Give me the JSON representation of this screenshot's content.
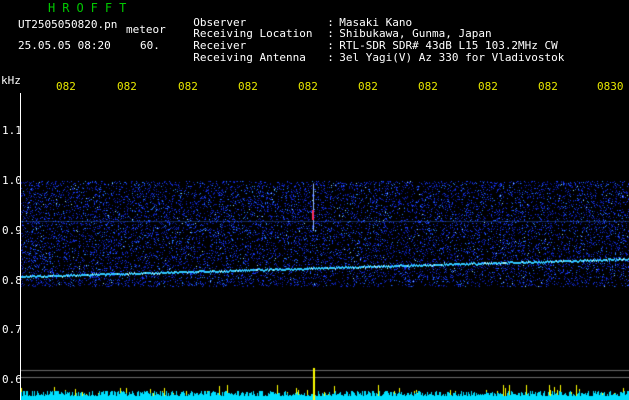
{
  "header": {
    "app_title": "HROFFT",
    "file_name": "UT2505050820.pn",
    "mode_label": "meteor",
    "datetime": "25.05.05 08:20",
    "interval": "60."
  },
  "station_info": [
    {
      "label": "Observer",
      "value": "Masaki Kano"
    },
    {
      "label": "Receiving Location",
      "value": "Shibukawa, Gunma, Japan"
    },
    {
      "label": "Receiver",
      "value": "RTL-SDR SDR# 43dB L15 103.2MHz CW"
    },
    {
      "label": "Receiving Antenna",
      "value": "3el Yagi(V) Az 330 for Vladivostok"
    }
  ],
  "axes": {
    "unit_label": "kHz",
    "time_ticks": [
      "082",
      "082",
      "082",
      "082",
      "082",
      "082",
      "082",
      "082",
      "082",
      "0830"
    ],
    "freq_ticks": [
      "1.1",
      "1.0",
      "0.9",
      "0.8",
      "0.7",
      "0.6"
    ]
  },
  "colors": {
    "background": "#000000",
    "time_tick": "#e6e600",
    "title": "#00c800",
    "noise": "#1a3cff",
    "trail": "#30c8ff",
    "meteor": "#ff3060",
    "level_bar": "#00e0ff",
    "level_peak": "#ffff00"
  },
  "chart_data": {
    "type": "heatmap",
    "x_ticks": [
      "082",
      "082",
      "082",
      "082",
      "082",
      "082",
      "082",
      "082",
      "082",
      "0830"
    ],
    "y_ticks": [
      1.1,
      1.0,
      0.9,
      0.8,
      0.7,
      0.6
    ],
    "y_unit": "kHz",
    "ylim": [
      0.6,
      1.1
    ],
    "noise_band_khz": [
      0.8,
      1.0
    ],
    "carrier_khz_start": 0.81,
    "carrier_khz_end": 0.845,
    "meteor_event": {
      "time_fraction": 0.48,
      "freq_range_khz": [
        0.9,
        0.995
      ],
      "peak_khz": 0.93
    }
  }
}
